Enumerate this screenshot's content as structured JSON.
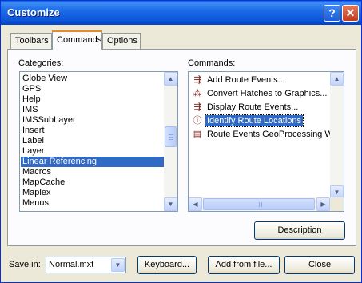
{
  "window": {
    "title": "Customize"
  },
  "tabs": [
    {
      "label": "Toolbars"
    },
    {
      "label": "Commands"
    },
    {
      "label": "Options"
    }
  ],
  "categories": {
    "label": "Categories:",
    "items": [
      "Globe View",
      "GPS",
      "Help",
      "IMS",
      "IMSSubLayer",
      "Insert",
      "Label",
      "Layer",
      "Linear Referencing",
      "Macros",
      "MapCache",
      "Maplex",
      "Menus"
    ],
    "selected": "Linear Referencing"
  },
  "commands": {
    "label": "Commands:",
    "items": [
      {
        "label": "Add Route Events...",
        "icon": "add-route-events-icon"
      },
      {
        "label": "Convert Hatches to Graphics...",
        "icon": "convert-hatches-icon"
      },
      {
        "label": "Display Route Events...",
        "icon": "display-route-events-icon"
      },
      {
        "label": "Identify Route Locations",
        "icon": "identify-route-icon"
      },
      {
        "label": "Route Events GeoProcessing Wizard",
        "icon": "geoprocessing-wizard-icon"
      }
    ],
    "selected": "Identify Route Locations"
  },
  "buttons": {
    "description": "Description",
    "keyboard": "Keyboard...",
    "add_from_file": "Add from file...",
    "close": "Close"
  },
  "save_in": {
    "label": "Save in:",
    "value": "Normal.mxt"
  },
  "colors": {
    "titlebar": "#0a53d8",
    "selection": "#316ac5",
    "dialog_bg": "#ece9d8",
    "tab_accent": "#e68b2c"
  }
}
